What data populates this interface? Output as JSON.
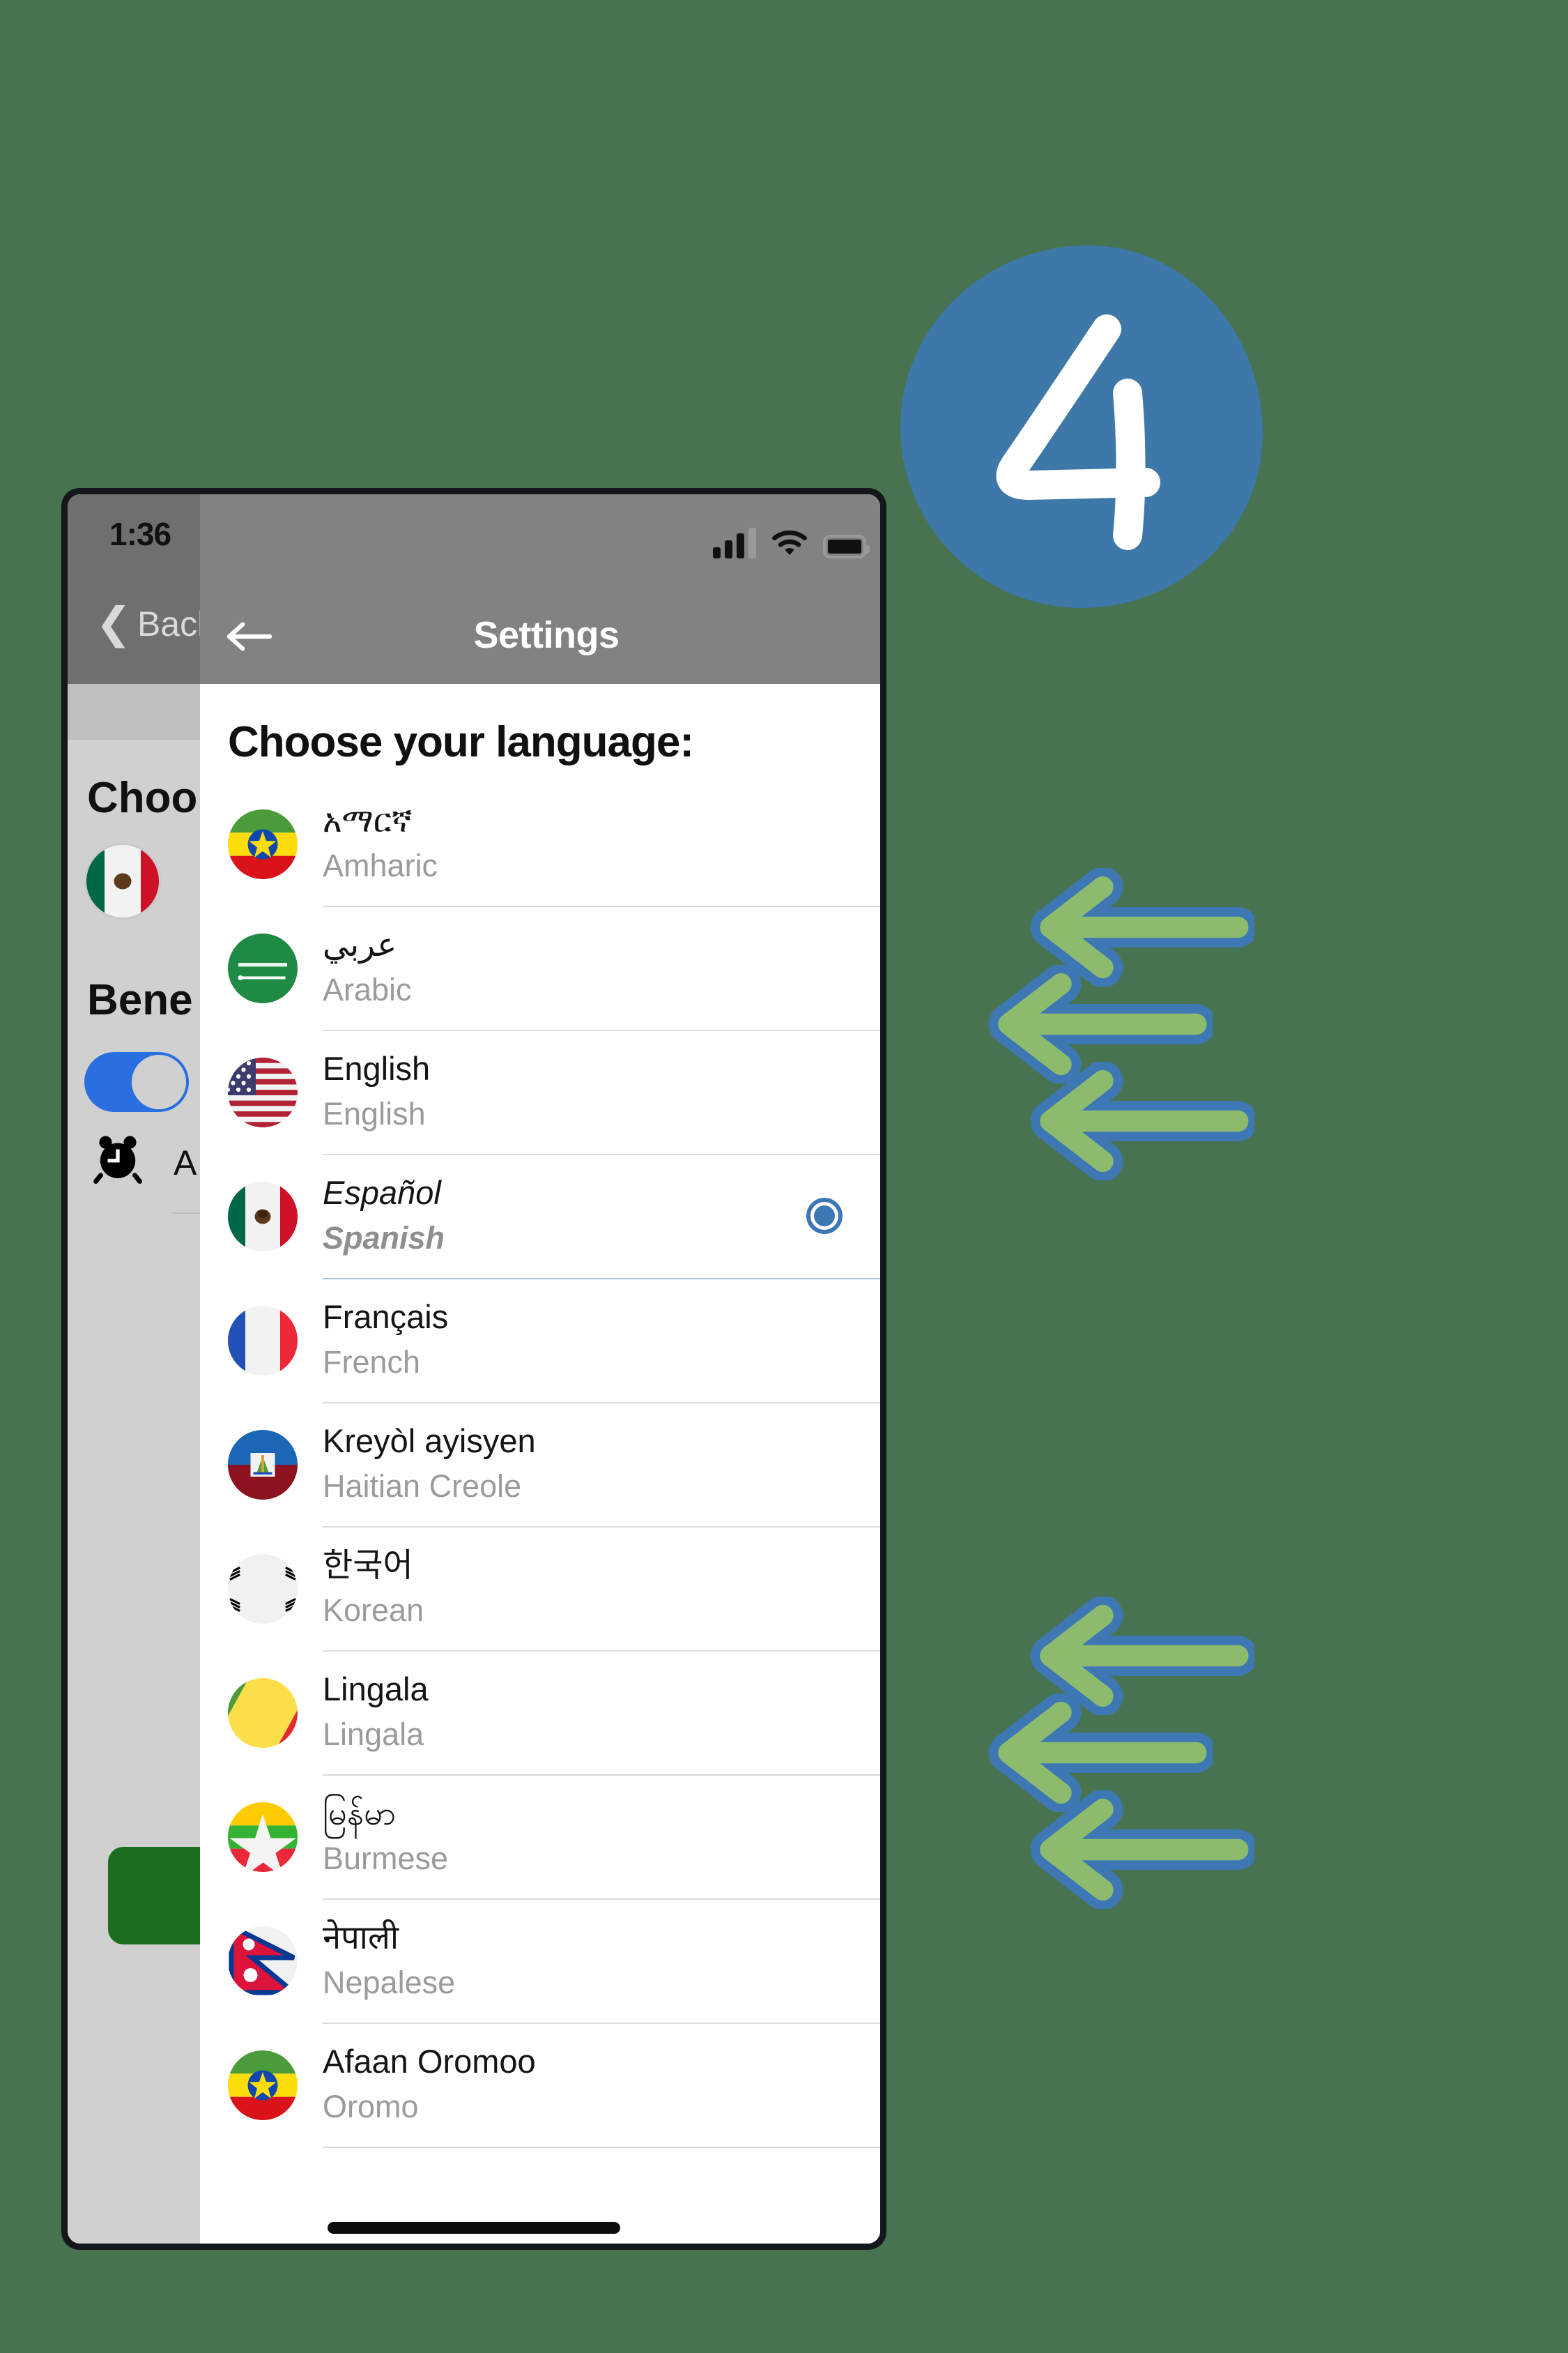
{
  "background_screen": {
    "status_time": "1:36",
    "back_label": "Back",
    "heading_1": "Choo",
    "heading_2": "Bene",
    "alarm_label": "A",
    "flag": "mexico-flag",
    "toggle_state": "on",
    "green_button_label": ""
  },
  "settings_screen": {
    "status_time": "1:36",
    "title": "Settings",
    "back_icon": "arrow-left-icon",
    "heading": "Choose your language:",
    "status_icons": {
      "signal": "cellular-signal-icon",
      "wifi": "wifi-icon",
      "battery": "battery-full-icon"
    },
    "languages": [
      {
        "native": "አማርኛ",
        "english": "Amharic",
        "flag": "ethiopia-flag",
        "selected": false
      },
      {
        "native": "عربي",
        "english": "Arabic",
        "flag": "saudi-arabia-flag",
        "selected": false
      },
      {
        "native": "English",
        "english": "English",
        "flag": "usa-flag",
        "selected": false
      },
      {
        "native": "Español",
        "english": "Spanish",
        "flag": "mexico-flag",
        "selected": true
      },
      {
        "native": "Français",
        "english": "French",
        "flag": "france-flag",
        "selected": false
      },
      {
        "native": "Kreyòl ayisyen",
        "english": "Haitian Creole",
        "flag": "haiti-flag",
        "selected": false
      },
      {
        "native": "한국어",
        "english": "Korean",
        "flag": "south-korea-flag",
        "selected": false
      },
      {
        "native": "Lingala",
        "english": "Lingala",
        "flag": "congo-flag",
        "selected": false
      },
      {
        "native": "မြန်မာ",
        "english": "Burmese",
        "flag": "myanmar-flag",
        "selected": false
      },
      {
        "native": "नेपाली",
        "english": "Nepalese",
        "flag": "nepal-flag",
        "selected": false
      },
      {
        "native": "Afaan Oromoo",
        "english": "Oromo",
        "flag": "ethiopia-flag",
        "selected": false
      }
    ]
  },
  "annotations": {
    "step_number": "4",
    "badge_color": "#3d78a8",
    "arrow_fill": "#8cbb6d",
    "arrow_stroke": "#3d78b4",
    "arrow_direction": "left",
    "arrow_group_counts": [
      3,
      3
    ]
  },
  "colors": {
    "page_background": "#477350",
    "phone_frame": "#14181c",
    "navbar": "#828282",
    "accent_blue": "#3d78b4",
    "green_button": "#1b6e1e",
    "muted_text": "#9b9b9b"
  }
}
